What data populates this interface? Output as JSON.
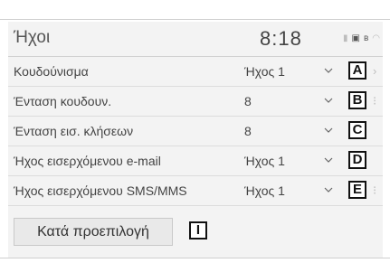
{
  "header": {
    "title": "Ήχοι",
    "clock": "8:18",
    "status_icons": [
      "signal-icon",
      "phone-icon",
      "bluetooth-icon",
      "wifi-icon"
    ]
  },
  "rows": [
    {
      "label": "Κουδούνισμα",
      "value": "Ήχος 1",
      "callout": "A"
    },
    {
      "label": "Ένταση κουδουν.",
      "value": "8",
      "callout": "B"
    },
    {
      "label": "Ένταση εισ. κλήσεων",
      "value": "8",
      "callout": "C"
    },
    {
      "label": "Ήχος εισερχόμενου e-mail",
      "value": "Ήχος 1",
      "callout": "D"
    },
    {
      "label": "Ήχος εισερχόμενου SMS/MMS",
      "value": "Ήχος 1",
      "callout": "E"
    }
  ],
  "default_button": {
    "label": "Κατά προεπιλογή",
    "callout": "I"
  },
  "colors": {
    "screen_bg": "#f3f3f3",
    "text": "#444444",
    "divider": "#dcdcdc",
    "callout_border": "#111111"
  }
}
